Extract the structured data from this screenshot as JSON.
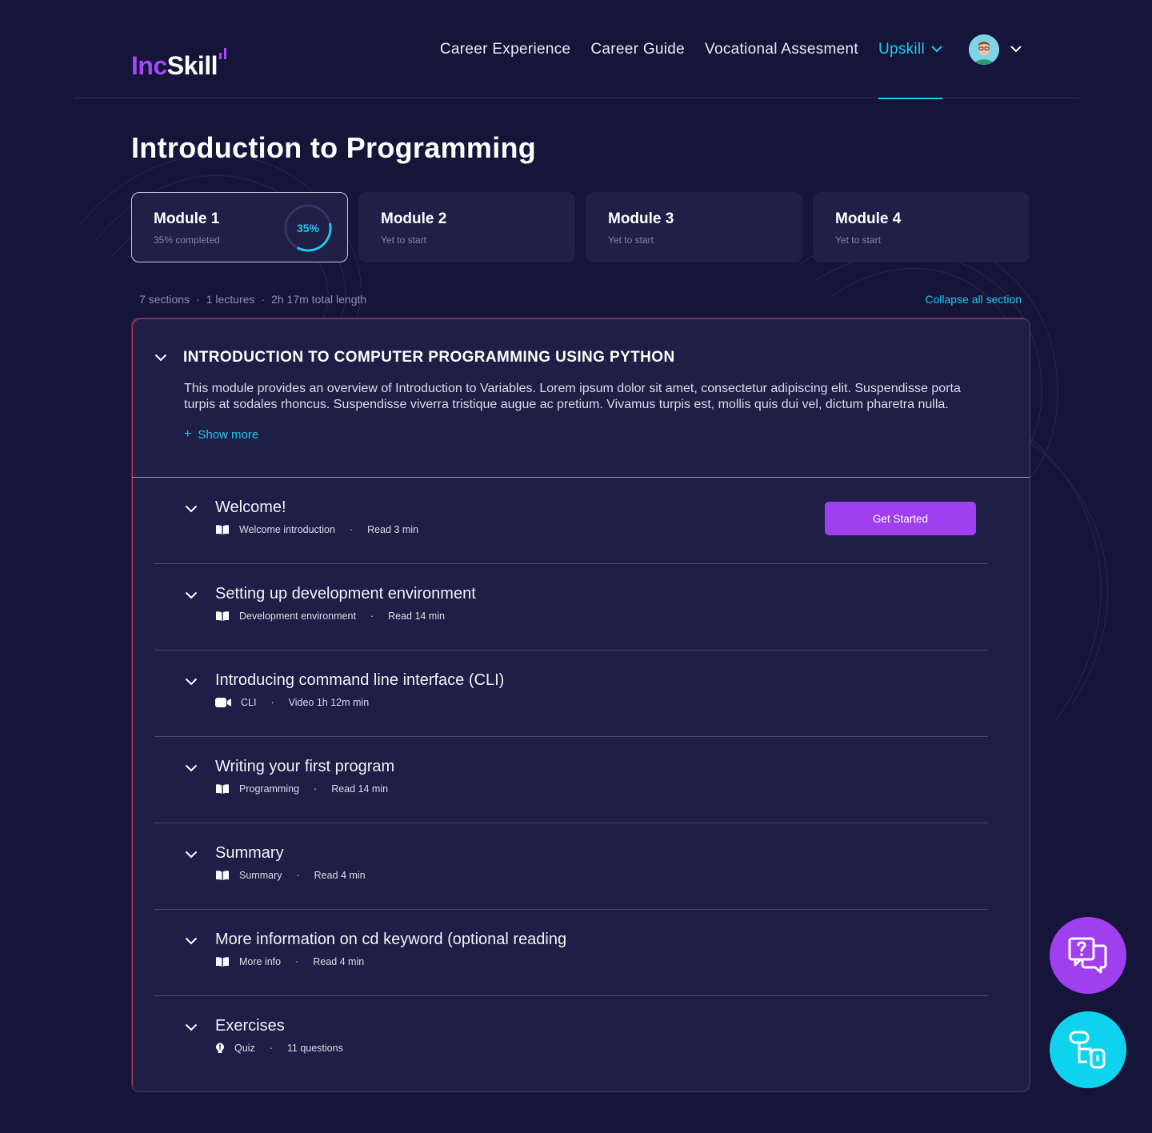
{
  "brand": {
    "logo_prefix": "Inc",
    "logo_suffix": "Skill",
    "accent": "#a03ff0",
    "cyan": "#1ec8ee",
    "background": "#15153a"
  },
  "nav": {
    "items": [
      {
        "label": "Career Experience"
      },
      {
        "label": "Career Guide"
      },
      {
        "label": "Vocational Assesment"
      },
      {
        "label": "Upskill",
        "active": true
      }
    ],
    "avatar_icon": "user-avatar",
    "dropdown_icon": "chevron-down-icon"
  },
  "page": {
    "title": "Introduction to Programming"
  },
  "modules": [
    {
      "name": "Module 1",
      "status": "35% completed",
      "progress_label": "35%",
      "progress": 0.35
    },
    {
      "name": "Module 2",
      "status": "Yet to start"
    },
    {
      "name": "Module 3",
      "status": "Yet to start"
    },
    {
      "name": "Module 4",
      "status": "Yet to start"
    }
  ],
  "course_meta": {
    "sections": "7 sections",
    "lectures": "1 lectures",
    "length": "2h 17m total length",
    "dot": "·",
    "collapse_label": "Collapse all section"
  },
  "section": {
    "title": "INTRODUCTION TO COMPUTER PROGRAMMING USING PYTHON",
    "description": "This module provides an overview of Introduction to Variables. Lorem ipsum dolor sit amet, consectetur adipiscing elit. Suspendisse porta turpis at sodales rhoncus. Suspendisse viverra tristique augue ac pretium. Vivamus turpis est, mollis quis dui vel, dictum pharetra nulla.",
    "show_more_icon": "+",
    "show_more": "Show more"
  },
  "lessons": [
    {
      "title": "Welcome!",
      "topic": "Welcome introduction",
      "detail": "Read 3 min",
      "icon": "book-icon",
      "action": "Get Started"
    },
    {
      "title": "Setting up development environment",
      "topic": "Development environment",
      "detail": "Read 14 min",
      "icon": "book-icon"
    },
    {
      "title": "Introducing command line interface (CLI)",
      "topic": "CLI",
      "detail": "Video 1h 12m min",
      "icon": "video-icon"
    },
    {
      "title": "Writing your first program",
      "topic": "Programming",
      "detail": "Read 14 min",
      "icon": "book-icon"
    },
    {
      "title": "Summary",
      "topic": "Summary",
      "detail": "Read 4 min",
      "icon": "book-icon"
    },
    {
      "title": "More information on cd keyword (optional reading",
      "topic": "More info",
      "detail": "Read 4 min",
      "icon": "book-icon"
    },
    {
      "title": "Exercises",
      "topic": "Quiz",
      "detail": "11 questions",
      "icon": "lightbulb-icon"
    }
  ],
  "lesson_separator": "·",
  "fabs": [
    {
      "icon": "help-chat-icon",
      "color": "#a03ff0"
    },
    {
      "icon": "flow-tool-icon",
      "color": "#0fd3ee"
    }
  ]
}
